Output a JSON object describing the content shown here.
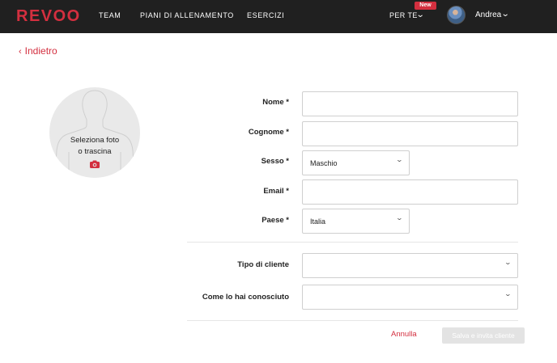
{
  "header": {
    "logo": "REVOO",
    "nav": [
      "TEAM",
      "PIANI DI ALLENAMENTO",
      "ESERCIZI"
    ],
    "for_you": "PER TE",
    "new_badge": "New",
    "user_name": "Andrea"
  },
  "back_label": "Indietro",
  "photo": {
    "line1": "Seleziona foto",
    "line2": "o trascina"
  },
  "form": {
    "name_label": "Nome *",
    "surname_label": "Cognome *",
    "sex_label": "Sesso *",
    "sex_value": "Maschio",
    "email_label": "Email *",
    "country_label": "Paese *",
    "country_value": "Italia",
    "client_type_label": "Tipo di cliente",
    "source_label": "Come lo hai conosciuto"
  },
  "actions": {
    "cancel": "Annulla",
    "save": "Salva e invita cliente"
  },
  "colors": {
    "brand": "#d32f3f",
    "header_bg": "#202020"
  }
}
